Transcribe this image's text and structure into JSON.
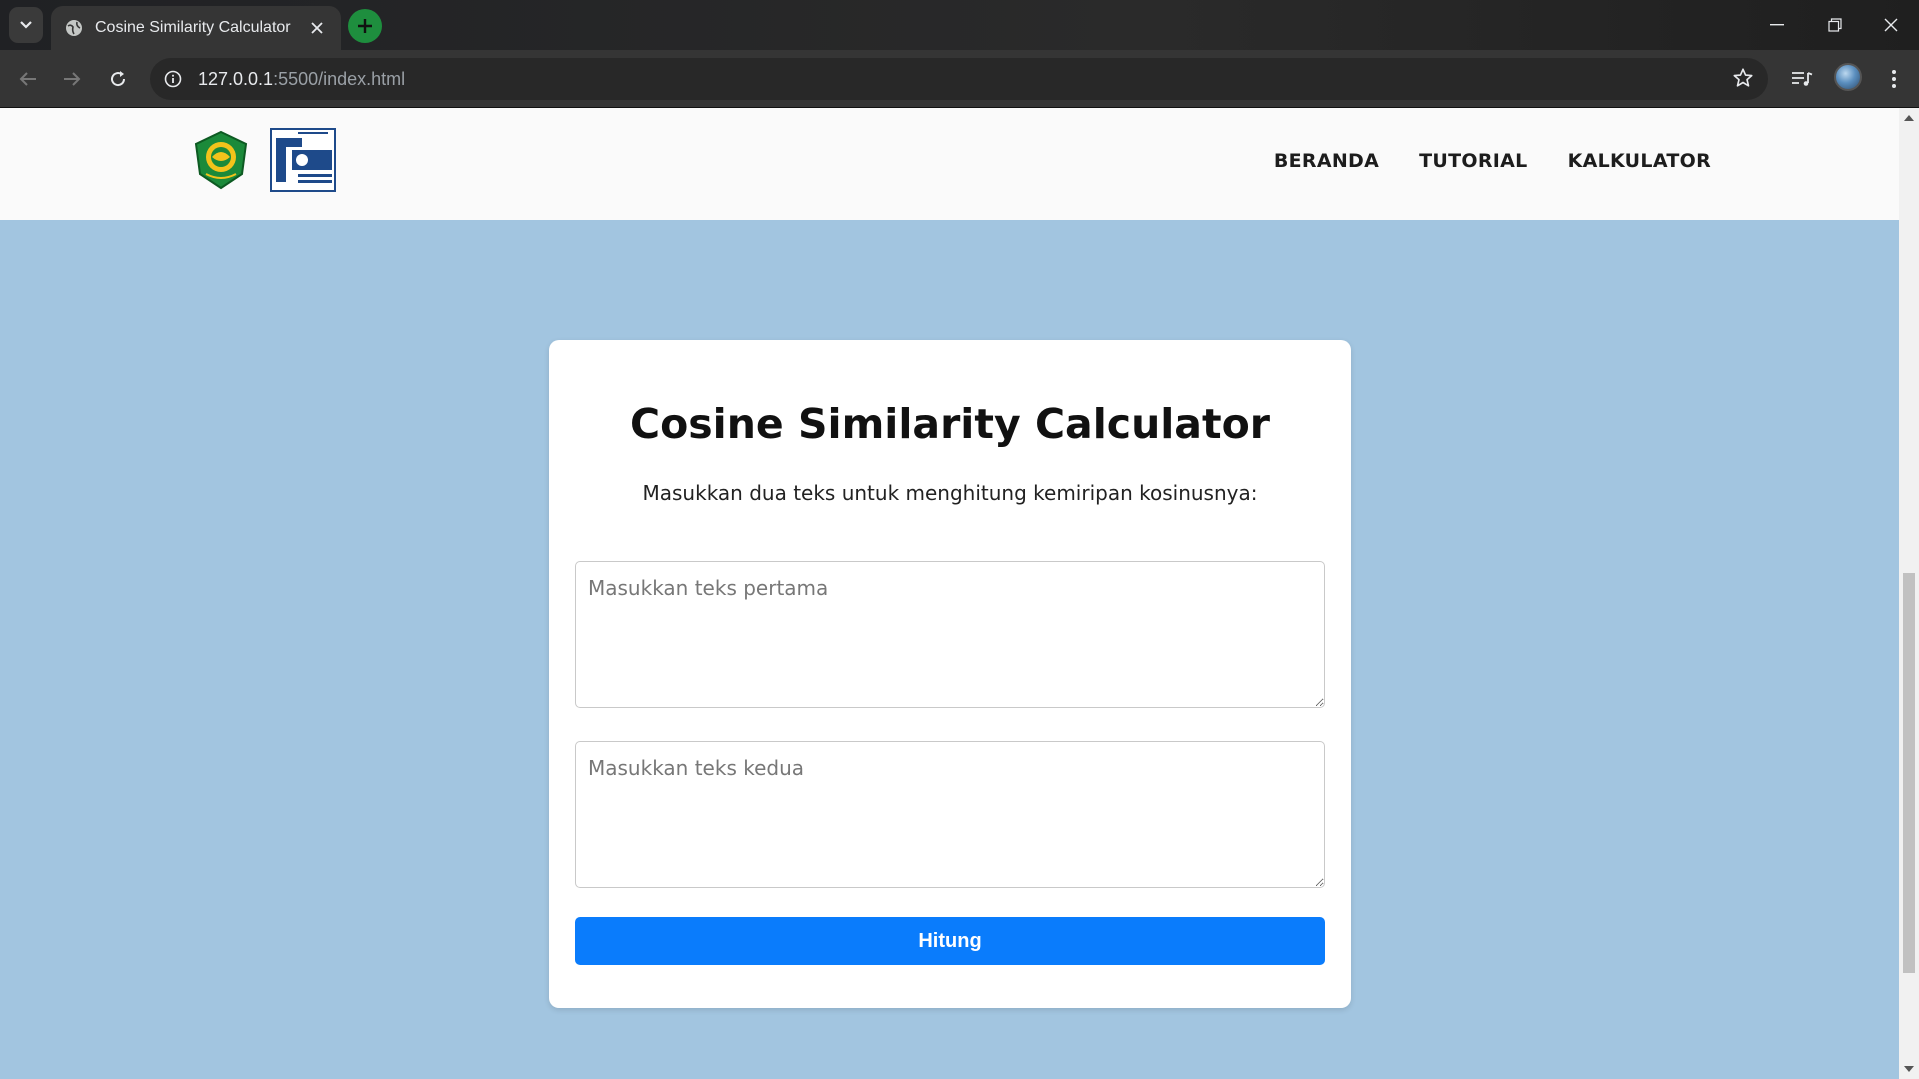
{
  "browser": {
    "tab_title": "Cosine Similarity Calculator",
    "url_host": "127.0.0.1",
    "url_rest": ":5500/index.html"
  },
  "site": {
    "nav": [
      "BERANDA",
      "TUTORIAL",
      "KALKULATOR"
    ]
  },
  "calculator": {
    "title": "Cosine Similarity Calculator",
    "subtitle": "Masukkan dua teks untuk menghitung kemiripan kosinusnya:",
    "input1_placeholder": "Masukkan teks pertama",
    "input2_placeholder": "Masukkan teks kedua",
    "submit_label": "Hitung"
  },
  "colors": {
    "page_background": "#a2c5e0",
    "button": "#0a7cfc",
    "header_background": "#fafafa"
  }
}
